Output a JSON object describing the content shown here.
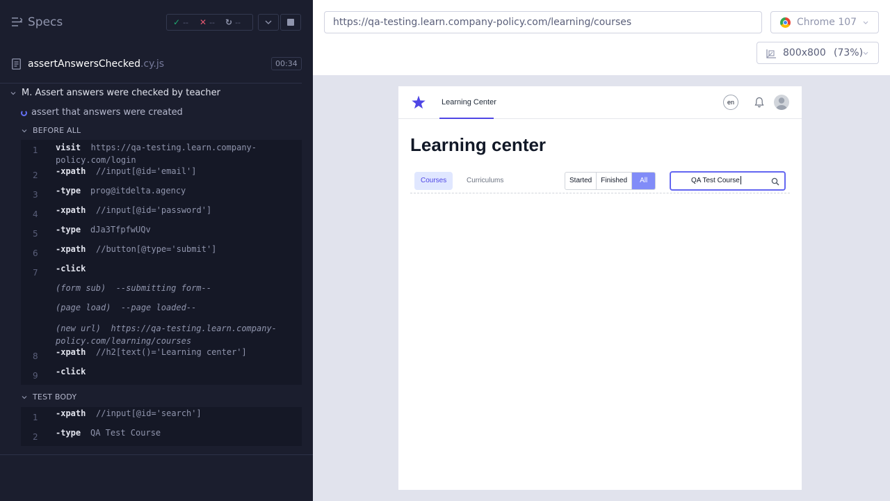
{
  "runner": {
    "title": "Specs",
    "stats": {
      "passed": "--",
      "failed": "--",
      "pending": "--"
    },
    "spec": {
      "name": "assertAnswersChecked",
      "ext": ".cy.js",
      "time": "00:34"
    },
    "suite": "M. Assert answers were checked by teacher",
    "test": "assert that answers were created",
    "before_all": {
      "label": "BEFORE ALL",
      "commands": [
        {
          "num": "1",
          "name": "visit",
          "msg": "https://qa-testing.learn.company-policy.com/login"
        },
        {
          "num": "2",
          "name": "-xpath",
          "msg": "//input[@id='email']"
        },
        {
          "num": "3",
          "name": "-type",
          "msg": "prog@itdelta.agency"
        },
        {
          "num": "4",
          "name": "-xpath",
          "msg": "//input[@id='password']"
        },
        {
          "num": "5",
          "name": "-type",
          "msg": "dJa3TfpfwUQv"
        },
        {
          "num": "6",
          "name": "-xpath",
          "msg": "//button[@type='submit']"
        },
        {
          "num": "7",
          "name": "-click",
          "msg": ""
        },
        {
          "num": "",
          "event": "(form sub)",
          "msg": "--submitting form--"
        },
        {
          "num": "",
          "event": "(page load)",
          "msg": "--page loaded--"
        },
        {
          "num": "",
          "event": "(new url)",
          "msg": "https://qa-testing.learn.company-policy.com/learning/courses"
        },
        {
          "num": "8",
          "name": "-xpath",
          "msg": "//h2[text()='Learning center']"
        },
        {
          "num": "9",
          "name": "-click",
          "msg": ""
        }
      ]
    },
    "test_body": {
      "label": "TEST BODY",
      "commands": [
        {
          "num": "1",
          "name": "-xpath",
          "msg": "//input[@id='search']"
        },
        {
          "num": "2",
          "name": "-type",
          "msg": "QA Test Course"
        }
      ]
    }
  },
  "topbar": {
    "url": "https://qa-testing.learn.company-policy.com/learning/courses",
    "browser": "Chrome 107",
    "viewport": "800x800",
    "zoom": "(73%)"
  },
  "app": {
    "nav_link": "Learning Center",
    "lang": "en",
    "heading": "Learning center",
    "tabs": [
      "Courses",
      "Curriculums"
    ],
    "filters": [
      "Started",
      "Finished",
      "All"
    ],
    "search_value": "QA Test Course"
  },
  "colors": {
    "accent": "#6470f3",
    "app_accent": "#4f46e5",
    "runner_bg": "#1b1e2e"
  }
}
